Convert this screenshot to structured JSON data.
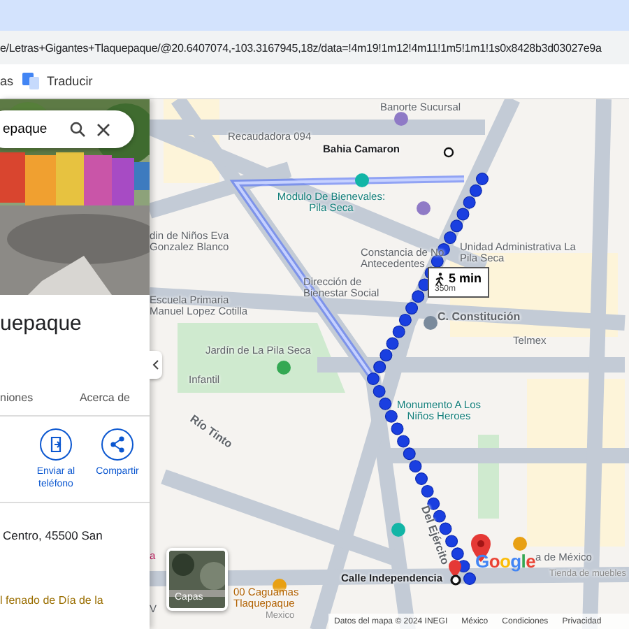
{
  "address_bar": {
    "url": "e/Letras+Gigantes+Tlaquepaque/@20.6407074,-103.3167945,18z/data=!4m19!1m12!4m11!1m5!1m1!1s0x8428b3d03027e9a"
  },
  "bookmarks": [
    "as",
    "Traducir"
  ],
  "place_panel": {
    "search": {
      "value": "epaque"
    },
    "title": "uepaque",
    "tabs": [
      {
        "label": "niones",
        "selected": false
      },
      {
        "label": "Acerca de",
        "selected": false
      }
    ],
    "actions": [
      {
        "kind": "send",
        "label": "Enviar al teléfono"
      },
      {
        "kind": "share",
        "label": "Compartir"
      }
    ],
    "address": "Centro, 45500 San",
    "notice": "l fenado de Día de la"
  },
  "map": {
    "labels": [
      {
        "kind": "place",
        "text": "Banorte Sucursal"
      },
      {
        "kind": "place",
        "text": "Recaudadora 094"
      },
      {
        "kind": "stop",
        "text": "Bahia Camaron"
      },
      {
        "kind": "teal",
        "text": "Modulo De Bienevales: Pila Seca"
      },
      {
        "kind": "place",
        "text": "din de Niños Eva Gonzalez Blanco"
      },
      {
        "kind": "place",
        "text": "Constancia de No Antecedentes"
      },
      {
        "kind": "place",
        "text": "Unidad Administrativa La Pila Seca"
      },
      {
        "kind": "place",
        "text": "Dirección de Bienestar Social"
      },
      {
        "kind": "place",
        "text": "Escuela Primaria Manuel Lopez Cotilla"
      },
      {
        "kind": "place",
        "text": "Jardín de La Pila Seca"
      },
      {
        "kind": "place",
        "text": "Infantil"
      },
      {
        "kind": "street",
        "text": "C. Constitución"
      },
      {
        "kind": "place",
        "text": "Telmex"
      },
      {
        "kind": "teal",
        "text": "Monumento A Los Niños Heroes"
      },
      {
        "kind": "street",
        "text": "Río Tinto"
      },
      {
        "kind": "street",
        "text": "Del Ejército"
      },
      {
        "kind": "stop",
        "text": "Calle Independencia"
      },
      {
        "kind": "food",
        "text": "00 Caguamas Tlaquepaque"
      },
      {
        "kind": "small",
        "text": "Mexico"
      },
      {
        "kind": "place",
        "text": "a de México"
      },
      {
        "kind": "small",
        "text": "Tienda de muebles"
      },
      {
        "kind": "pink",
        "text": "a"
      },
      {
        "kind": "place",
        "text": "V"
      }
    ],
    "walk": {
      "time": "5 min",
      "distance": "350m"
    },
    "layers": "Capas",
    "logo": [
      "G",
      "o",
      "o",
      "g",
      "l",
      "e"
    ],
    "footer": [
      "Datos del mapa © 2024 INEGI",
      "México",
      "Condiciones",
      "Privacidad"
    ]
  }
}
